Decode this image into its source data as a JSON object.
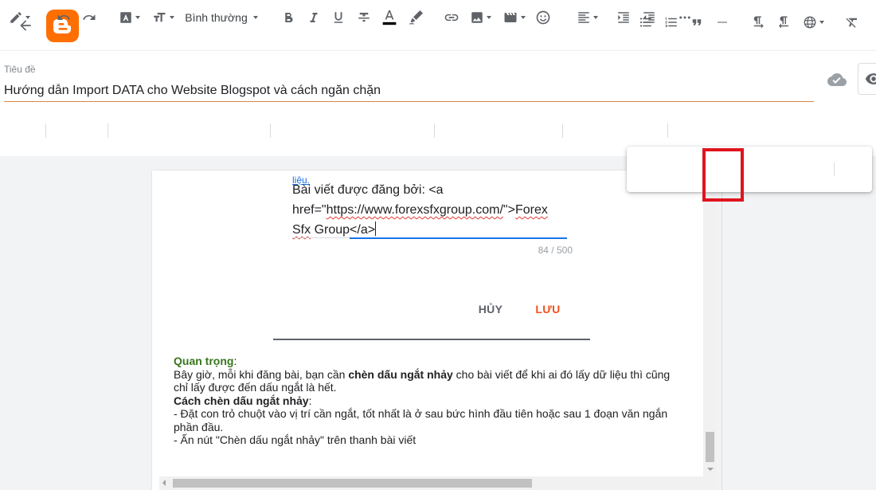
{
  "header": {
    "back_icon": "arrow-left-icon",
    "logo_icon": "blogger-logo-icon",
    "brand_color": "#ff6f00"
  },
  "post": {
    "title_label": "Tiêu đề",
    "title_value": "Hướng dẫn Import DATA cho Website Blogspot và cách ngăn chặn"
  },
  "toolbar": {
    "format_select": "Bình thường"
  },
  "more_toolbar": {
    "items": [
      "bulleted-list-icon",
      "numbered-list-icon",
      "quote-icon",
      "horizontal-line-icon",
      "ltr-icon",
      "rtl-icon",
      "language-icon",
      "clear-formatting-icon"
    ]
  },
  "dialog": {
    "above_text": "liệu.",
    "code_lines": {
      "l1a": "Bài viết được đăng bởi: <a",
      "l2a": "href=\"",
      "l2b": "https://www.forexsfxgroup.com/",
      "l2c": "\">",
      "l2d": "Forex",
      "l3a": "Sfx",
      "l3b": " Group</a>"
    },
    "counter": "84 / 500",
    "cancel_label": "HỦY",
    "save_label": "LƯU"
  },
  "document": {
    "important_label": "Quan trọng",
    "important_colon": ":",
    "para1_a": "Bây giờ, mỗi khi đăng bài, bạn cần ",
    "para1_b": "chèn dấu ngắt nhảy",
    "para1_c": " cho bài viết để khi ai đó lấy dữ liệu thì cũng chỉ lấy được đến dấu ngắt là hết.",
    "howto_label": "Cách chèn dấu ngắt nhảy",
    "howto_colon": ":",
    "step1": "- Đặt con trỏ chuột vào vị trí cần ngắt, tốt nhất là ở sau bức hình đầu tiên hoặc sau 1 đoạn văn ngắn phần đầu.",
    "step2": "- Ấn nút \"Chèn dấu ngắt nhảy\" trên thanh bài viết"
  },
  "colors": {
    "accent_orange": "#f4511e",
    "focus_blue": "#1a73e8",
    "highlight_red": "#e0141e",
    "important_green": "#38761d"
  }
}
